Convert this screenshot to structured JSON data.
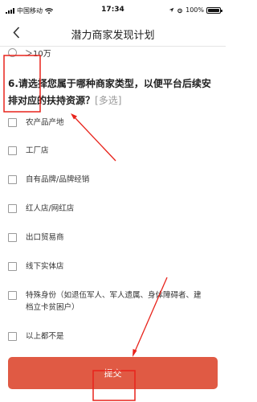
{
  "status_bar": {
    "carrier": "中国移动",
    "time": "17:34",
    "battery_text": "100%",
    "battery_level": 1.0
  },
  "nav": {
    "title": "潜力商家发现计划",
    "back_icon": "chevron-left-icon"
  },
  "previous_option": {
    "label": "＞10万"
  },
  "question": {
    "text": "6.请选择您属于哪种商家类型，以便平台后续安排对应的扶持资源？",
    "tag": "[多选]"
  },
  "options": [
    {
      "label": "农产品产地"
    },
    {
      "label": "工厂店"
    },
    {
      "label": "自有品牌/品牌经销"
    },
    {
      "label": "红人店/网红店"
    },
    {
      "label": "出口贸易商"
    },
    {
      "label": "线下实体店"
    },
    {
      "label": "特殊身份（如退伍军人、军人遗属、身体障碍者、建档立卡贫困户）"
    },
    {
      "label": "以上都不是"
    }
  ],
  "submit": {
    "label": "提交"
  },
  "colors": {
    "accent": "#e05a44",
    "annotation": "#e8231b"
  }
}
